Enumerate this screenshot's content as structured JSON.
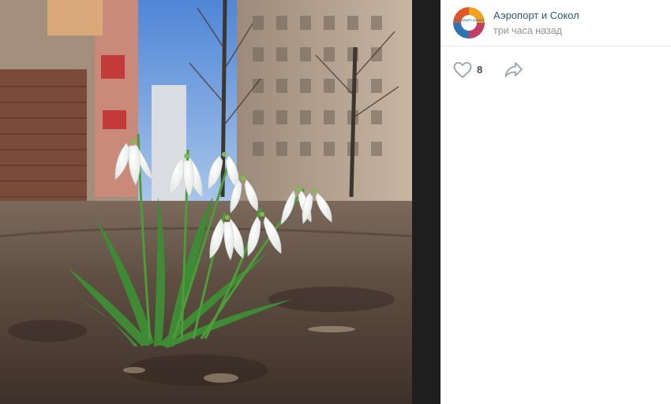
{
  "post": {
    "group_name": "Аэропорт и Сокол",
    "time": "три часа назад",
    "likes_count": "8",
    "avatar_logo_text": "АЭРОПОРТ СОКОЛ"
  },
  "icons": {
    "like": "heart-icon",
    "share": "share-arrow-icon"
  },
  "colors": {
    "link": "#2a5885",
    "muted": "#939393",
    "icon": "#99a2ad",
    "panel_bg": "#ffffff",
    "backdrop": "#000000"
  }
}
